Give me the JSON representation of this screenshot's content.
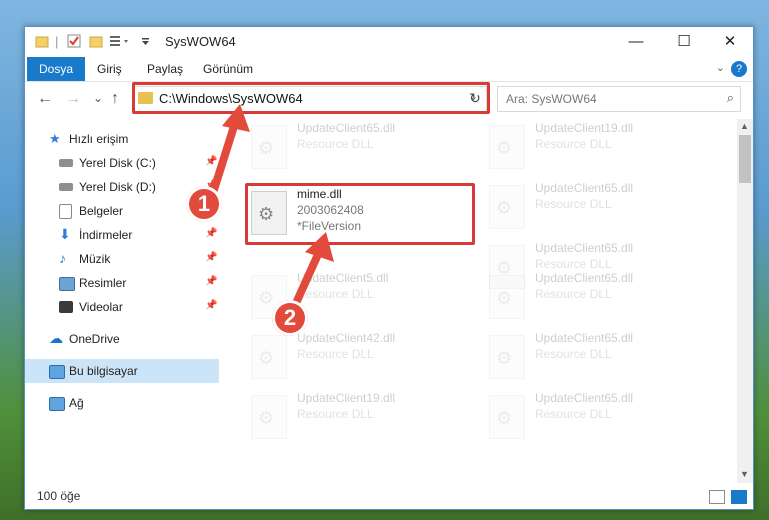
{
  "window": {
    "title": "SysWOW64",
    "controls": {
      "minimize": "—",
      "maximize": "☐",
      "close": "✕"
    }
  },
  "ribbon": {
    "tabs": [
      {
        "label": "Dosya",
        "active": true
      },
      {
        "label": "Giriş"
      },
      {
        "label": "Paylaş"
      },
      {
        "label": "Görünüm"
      }
    ],
    "help": "?"
  },
  "navigation": {
    "back": "←",
    "forward": "→",
    "recent": "⌄",
    "up": "↑",
    "address": "C:\\Windows\\SysWOW64",
    "refresh": "↻",
    "search_placeholder": "Ara: SysWOW64"
  },
  "sidebar": {
    "items": [
      {
        "label": "Hızlı erişim",
        "icon": "star-icon"
      },
      {
        "label": "Yerel Disk (C:)",
        "icon": "drive-icon",
        "pinned": true
      },
      {
        "label": "Yerel Disk (D:)",
        "icon": "drive-icon",
        "pinned": true
      },
      {
        "label": "Belgeler",
        "icon": "documents-icon",
        "pinned": true
      },
      {
        "label": "İndirmeler",
        "icon": "download-icon",
        "pinned": true
      },
      {
        "label": "Müzik",
        "icon": "music-icon",
        "pinned": true
      },
      {
        "label": "Resimler",
        "icon": "pictures-icon",
        "pinned": true
      },
      {
        "label": "Videolar",
        "icon": "videos-icon",
        "pinned": true
      },
      {
        "label": "OneDrive",
        "icon": "cloud-icon"
      },
      {
        "label": "Bu bilgisayar",
        "icon": "computer-icon",
        "selected": true
      },
      {
        "label": "Ağ",
        "icon": "network-icon"
      }
    ]
  },
  "files": [
    {
      "name": "UpdateClient65.dll",
      "type": "Resource DLL",
      "faded": true
    },
    {
      "name": "UpdateClient19.dll",
      "type": "Resource DLL",
      "faded": true
    },
    {
      "name": "",
      "type": "",
      "faded": true
    },
    {
      "name": "UpdateClient65.dll",
      "type": "Resource DLL",
      "faded": true
    },
    {
      "name": "mime.dll",
      "line2": "2003062408",
      "line3": "*FileVersion",
      "faded": false
    },
    {
      "name": "UpdateClient65.dll",
      "type": "Resource DLL",
      "faded": true
    },
    {
      "name": "UpdateClient5.dll",
      "type": "Resource DLL",
      "faded": true
    },
    {
      "name": "UpdateClient65.dll",
      "type": "Resource DLL",
      "faded": true
    },
    {
      "name": "UpdateClient42.dll",
      "type": "Resource DLL",
      "faded": true
    },
    {
      "name": "UpdateClient65.dll",
      "type": "Resource DLL",
      "faded": true
    },
    {
      "name": "UpdateClient19.dll",
      "type": "Resource DLL",
      "faded": true
    },
    {
      "name": "UpdateClient65.dll",
      "type": "Resource DLL",
      "faded": true
    }
  ],
  "annotations": {
    "step1": "1",
    "step2": "2",
    "highlight_color": "#d83a35"
  },
  "status": {
    "count": "100 öğe"
  }
}
